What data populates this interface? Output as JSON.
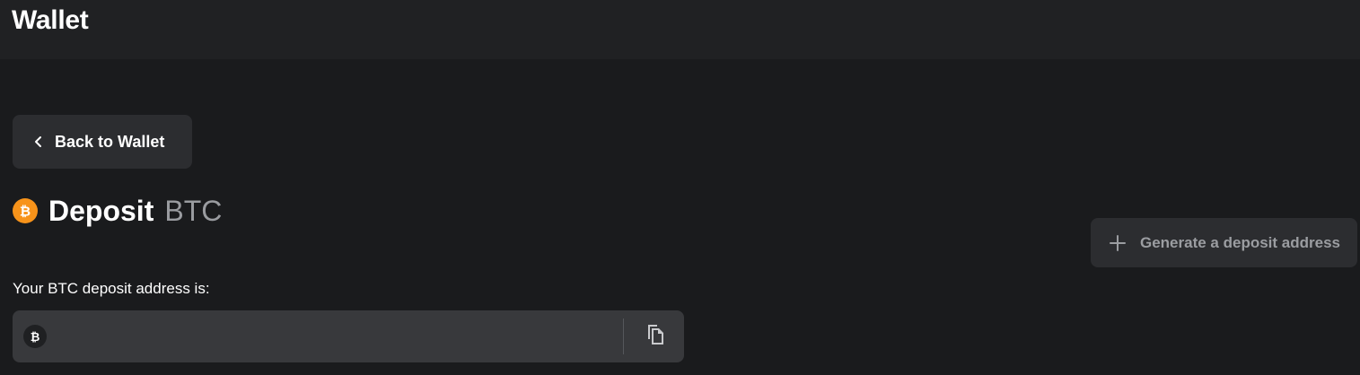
{
  "header": {
    "title": "Wallet"
  },
  "back_button": {
    "label": "Back to Wallet",
    "icon": "chevron-left-icon"
  },
  "page": {
    "title": "Deposit",
    "currency": "BTC",
    "currency_icon": "bitcoin-icon"
  },
  "generate_button": {
    "label": "Generate a deposit address",
    "icon": "plus-icon"
  },
  "deposit": {
    "label": "Your BTC deposit address is:",
    "address_value": "",
    "copy_icon": "copy-icon"
  },
  "colors": {
    "background": "#1a1b1d",
    "header_bg": "#202123",
    "button_bg": "#2c2d30",
    "input_bg": "#38393c",
    "bitcoin_orange": "#f7931a",
    "muted_text": "#9a9ca0"
  }
}
